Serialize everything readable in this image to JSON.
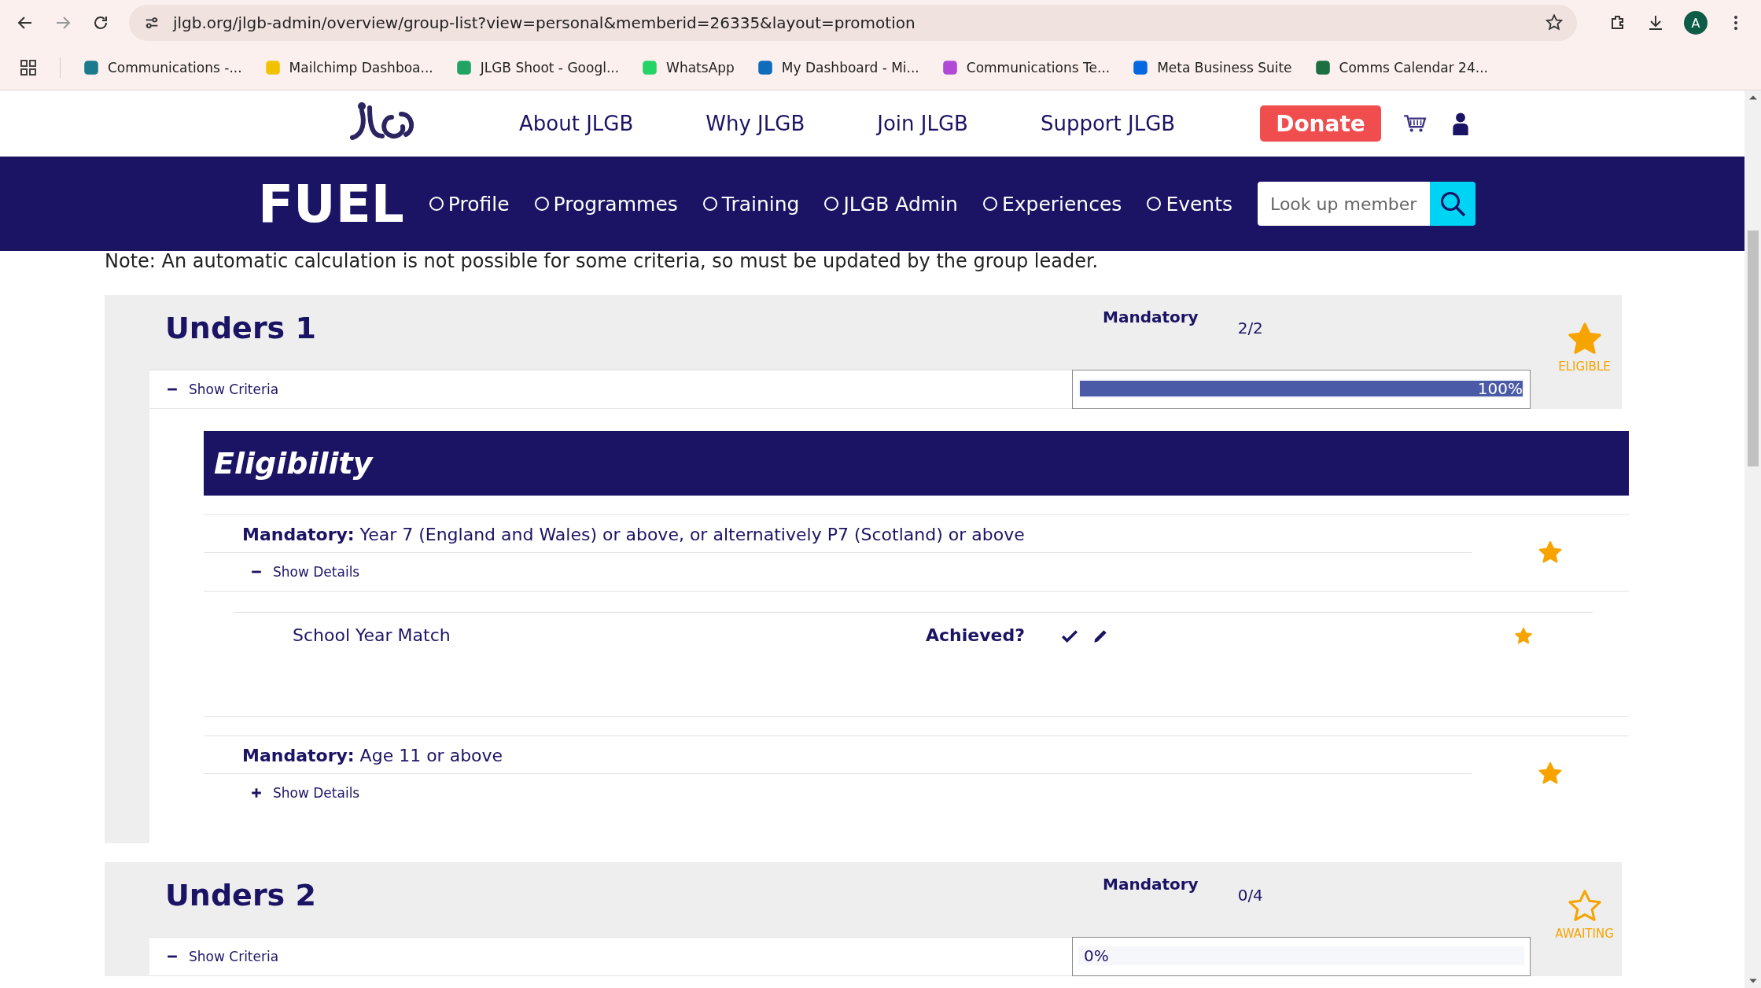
{
  "browser": {
    "url": "jlgb.org/jlgb-admin/overview/group-list?view=personal&memberid=26335&layout=promotion",
    "profile_initial": "A",
    "bookmarks": [
      {
        "label": "Communications -...",
        "color": "#1b7a8c"
      },
      {
        "label": "Mailchimp Dashboa...",
        "color": "#f2c200"
      },
      {
        "label": "JLGB Shoot - Googl...",
        "color": "#1fa463"
      },
      {
        "label": "WhatsApp",
        "color": "#25d366"
      },
      {
        "label": "My Dashboard - Mi...",
        "color": "#0f6cbd"
      },
      {
        "label": "Communications Te...",
        "color": "#b04ad6"
      },
      {
        "label": "Meta Business Suite",
        "color": "#0668e1"
      },
      {
        "label": "Comms Calendar 24...",
        "color": "#1d6f42"
      }
    ]
  },
  "site_header": {
    "links": [
      "About JLGB",
      "Why JLGB",
      "Join JLGB",
      "Support JLGB"
    ],
    "donate": "Donate"
  },
  "fuel_nav": {
    "brand": "FUEL",
    "items": [
      "Profile",
      "Programmes",
      "Training",
      "JLGB Admin",
      "Experiences",
      "Events"
    ],
    "search": {
      "placeholder": "Look up member"
    }
  },
  "note": "Note: An automatic calculation is not possible for some criteria, so must be updated by the group leader.",
  "sections": [
    {
      "title": "Unders 1",
      "requirement": "Mandatory",
      "count": "2/2",
      "level": 1,
      "reading": "100%",
      "status": "ELIGIBLE",
      "achieved": true,
      "criteria_toggle": {
        "label": "Show Criteria",
        "expanded": true
      },
      "groups": [
        {
          "heading": "Eligibility",
          "criteria": [
            {
              "label": "Mandatory:",
              "text": "Year 7 (England and Wales) or above, or alternatively P7 (Scotland) or above",
              "achieved": true,
              "toggle": {
                "label": "Show Details",
                "expanded": true
              },
              "details": [
                {
                  "name": "School Year Match",
                  "question": "Achieved?",
                  "achieved": true
                }
              ]
            },
            {
              "label": "Mandatory:",
              "text": "Age 11 or above",
              "achieved": true,
              "toggle": {
                "label": "Show Details",
                "expanded": false
              }
            }
          ]
        }
      ]
    },
    {
      "title": "Unders 2",
      "requirement": "Mandatory",
      "count": "0/4",
      "level": 0,
      "reading": "0%",
      "status": "AWAITING",
      "achieved": false,
      "criteria_toggle": {
        "label": "Show Criteria",
        "expanded": true
      }
    }
  ]
}
